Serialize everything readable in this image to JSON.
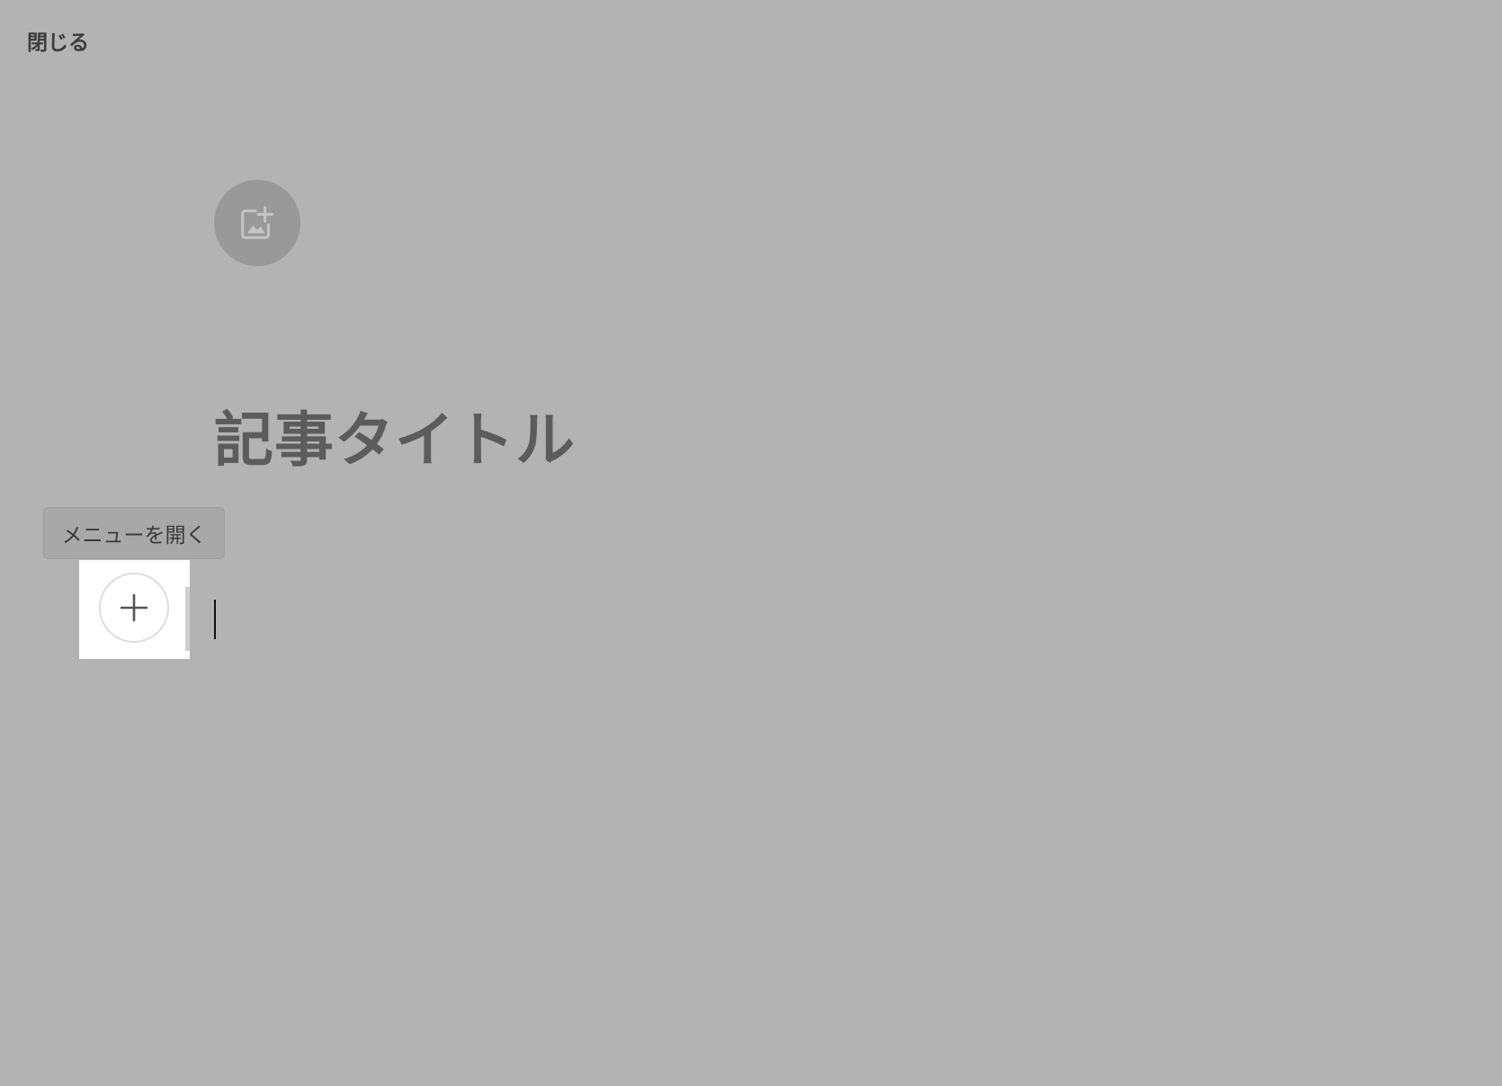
{
  "header": {
    "close_label": "閉じる"
  },
  "cover": {
    "icon": "image-add-icon"
  },
  "editor": {
    "title_placeholder": "記事タイトル",
    "add_menu_tooltip": "メニューを開く",
    "add_icon": "plus-icon"
  },
  "colors": {
    "overlay_background": "#b3b3b3",
    "cover_button": "#999999",
    "title_text": "#5c5c5c"
  }
}
